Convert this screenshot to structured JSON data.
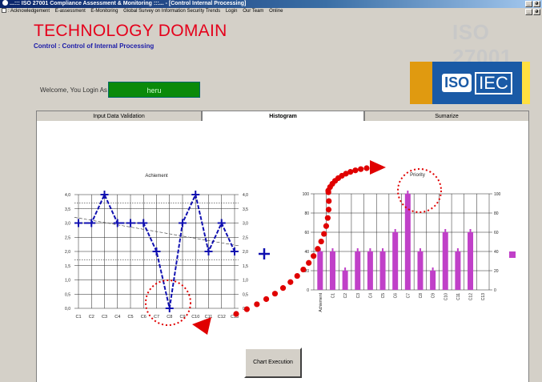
{
  "window": {
    "title": "ISO 27001 Compliance Assessment & Monitoring :::... - [Control Internal Processing]",
    "title_prefix": "...:::",
    "buttons": [
      "_",
      "ə",
      "x"
    ]
  },
  "menu": {
    "items": [
      "Acknowledgement",
      "E-assessment",
      "E-Monitoring",
      "Global Survey on Information Security Trends",
      "Login",
      "Our Team",
      "Online"
    ]
  },
  "header": {
    "domain_title": "TECHNOLOGY DOMAIN",
    "control_line": "Control : Control of Internal Processing",
    "iso_title": "ISO 27001",
    "logo_iso": "ISO",
    "logo_iec": "IEC"
  },
  "user": {
    "welcome_label": "Welcome, You Login As",
    "username": "heru"
  },
  "tabs": [
    {
      "label": "Input Data Validation",
      "active": false
    },
    {
      "label": "Histogram",
      "active": true
    },
    {
      "label": "Sumarize",
      "active": false
    }
  ],
  "buttons": {
    "chart_execution": "Chart Execution"
  },
  "colors": {
    "brand_red": "#e5001b",
    "control_blue": "#1a1aa8",
    "line_series": "#1010b0",
    "bar_series": "#c040c8",
    "annotation": "#e00000",
    "user_box": "#0a8a0a"
  },
  "chart_data": [
    {
      "type": "line",
      "title": "Achiement",
      "categories": [
        "C1",
        "C2",
        "C3",
        "C4",
        "C5",
        "C6",
        "C7",
        "C8",
        "C9",
        "C10",
        "C11",
        "C12",
        "C13"
      ],
      "series": [
        {
          "values": [
            3.0,
            3.0,
            4.0,
            3.0,
            3.0,
            3.0,
            2.0,
            0.0,
            3.0,
            4.0,
            2.0,
            3.0,
            2.0
          ]
        }
      ],
      "trendline": {
        "start": 3.2,
        "end": 2.2
      },
      "reference_lines": [
        3.7,
        3.5,
        1.7
      ],
      "ylim": [
        0,
        4
      ],
      "yticks": [
        "4,0",
        "3,5",
        "3,0",
        "2,5",
        "2,0",
        "1,5",
        "1,0",
        "0,5",
        "0,0"
      ],
      "grid": true,
      "legend": "right",
      "legend_marker": "cross"
    },
    {
      "type": "bar",
      "title": "Priority",
      "categories": [
        "Achiement",
        "C1",
        "C2",
        "C3",
        "C4",
        "C5",
        "C6",
        "C7",
        "C8",
        "C9",
        "C10",
        "C11",
        "C12",
        "C13"
      ],
      "series": [
        {
          "values": [
            40,
            40,
            20,
            40,
            40,
            40,
            60,
            100,
            40,
            20,
            60,
            40,
            60
          ]
        }
      ],
      "ylim": [
        0,
        100
      ],
      "yticks": [
        "100",
        "80",
        "60",
        "40",
        "20",
        "0"
      ],
      "grid": true,
      "legend": "right",
      "legend_marker": "square"
    }
  ]
}
